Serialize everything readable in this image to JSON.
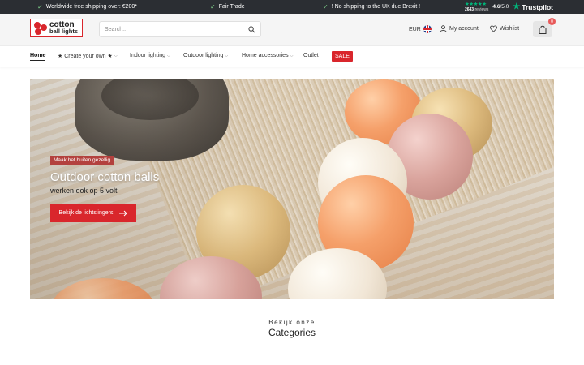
{
  "topbar": {
    "usps": [
      "Worldwide free shipping over: €200*",
      "Fair Trade",
      "! No shipping to the UK due Brexit !"
    ],
    "trustpilot": {
      "review_count": "2643",
      "reviews_label": "reviews",
      "score": "4.6",
      "score_max": "/5.0",
      "brand": "Trustpilot"
    }
  },
  "header": {
    "logo": {
      "line1": "cotton",
      "line2": "ball lights",
      "tagline": "the original"
    },
    "search": {
      "placeholder": "Search.."
    },
    "currency": "EUR",
    "account_label": "My account",
    "wishlist_label": "Wishlist",
    "cart_count": "0"
  },
  "nav": {
    "items": [
      {
        "label": "Home"
      },
      {
        "label": "★ Create your own ★"
      },
      {
        "label": "Indoor lighting"
      },
      {
        "label": "Outdoor lighting"
      },
      {
        "label": "Home accessories"
      },
      {
        "label": "Outlet"
      }
    ],
    "sale_label": "SALE"
  },
  "hero": {
    "tag": "Maak het buiten gezellig",
    "title": "Outdoor cotton balls",
    "subtitle": "werken ook op 5 volt",
    "button_label": "Bekijk de lichtslingers"
  },
  "categories": {
    "pre_title": "Bekijk onze",
    "title": "Categories"
  },
  "colors": {
    "brand_red": "#d9262c",
    "topbar_bg": "#2b2e33",
    "trustpilot_green": "#00b67a"
  }
}
